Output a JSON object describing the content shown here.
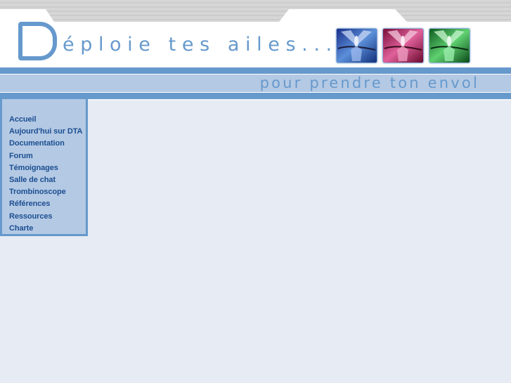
{
  "header": {
    "logo_letter": "D",
    "tagline": "éploie tes ailes...",
    "subtitle": "pour prendre ton envol",
    "thumbnails": [
      {
        "name": "angel-blue",
        "color": "#2a5bb8"
      },
      {
        "name": "angel-red",
        "color": "#b8245a"
      },
      {
        "name": "angel-green",
        "color": "#2a9a3a"
      }
    ]
  },
  "sidebar": {
    "items": [
      {
        "label": "Accueil"
      },
      {
        "label": "Aujourd'hui sur DTA"
      },
      {
        "label": "Documentation"
      },
      {
        "label": "Forum"
      },
      {
        "label": "Témoignages"
      },
      {
        "label": "Salle de chat"
      },
      {
        "label": "Trombinoscope"
      },
      {
        "label": "Références"
      },
      {
        "label": "Ressources"
      },
      {
        "label": "Charte"
      }
    ]
  },
  "colors": {
    "accent": "#6699cc",
    "band_light": "#b4c9e4",
    "link": "#1c4f91",
    "page_bg": "#e6ebf4",
    "stripe_gray": "#cfcfcf"
  }
}
